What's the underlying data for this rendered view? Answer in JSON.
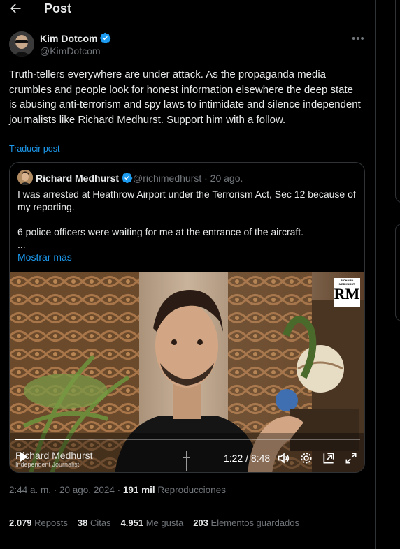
{
  "header": {
    "title": "Post"
  },
  "author": {
    "name": "Kim Dotcom",
    "handle": "@KimDotcom"
  },
  "post": {
    "text": "Truth-tellers everywhere are under attack. As the propaganda media crumbles and people look for honest information elsewhere the deep state is abusing anti-terrorism and spy laws to intimidate and silence independent journalists like Richard Medhurst. Support him with a follow.",
    "translate_label": "Traducir post"
  },
  "quote": {
    "name": "Richard Medhurst",
    "handle_date": "@richimedhurst · 20 ago.",
    "line1": "I was arrested at Heathrow Airport under the Terrorism Act, Sec 12 because of my reporting.",
    "line2": "6 police officers were waiting for me at the entrance of the aircraft.",
    "line3": "...",
    "show_more": "Mostrar más"
  },
  "video": {
    "logo_text": "RM",
    "logo_small": "RICHARD MEDHURST",
    "lower_third_name": "Richard Medhurst",
    "lower_third_role": "Independent Journalist",
    "time": "1:22 / 8:48",
    "progress": 0.155
  },
  "meta": {
    "time": "2:44 a. m. · 20 ago. 2024 · ",
    "views": "191 mil",
    "views_label": " Reproducciones"
  },
  "stats": {
    "reposts": "2.079",
    "reposts_label": " Reposts",
    "quotes": "38",
    "quotes_label": " Citas",
    "likes": "4.951",
    "likes_label": " Me gusta",
    "bookmarks": "203",
    "bookmarks_label": " Elementos guardados"
  },
  "colors": {
    "accent": "#1d9bf0",
    "background": "#000000",
    "muted": "#71767b",
    "border": "#2f3336"
  }
}
